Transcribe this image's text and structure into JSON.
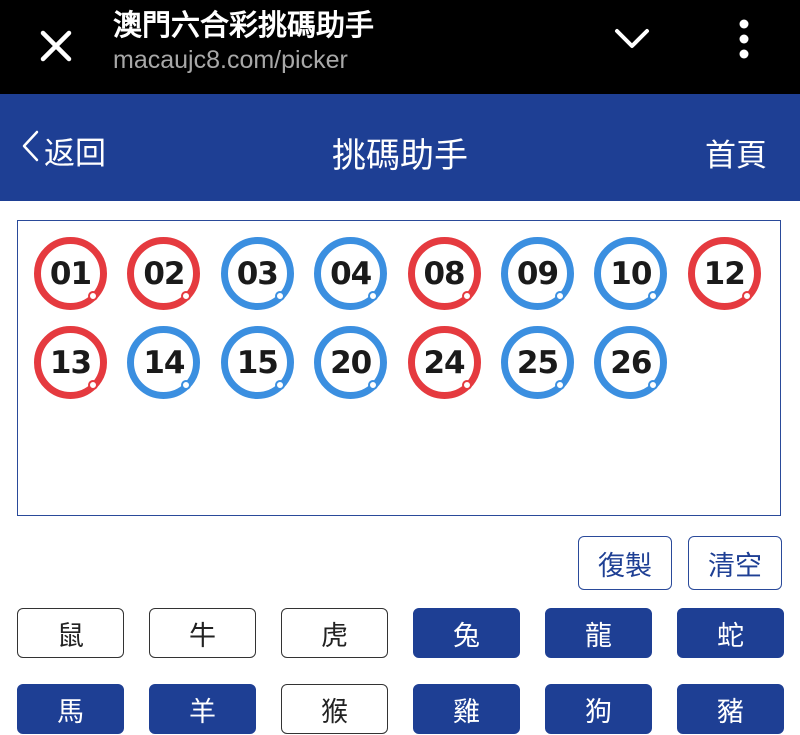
{
  "browser_bar": {
    "title": "澳門六合彩挑碼助手",
    "url": "macaujc8.com/picker",
    "icons": [
      "close-icon",
      "chevron-down-icon",
      "more-vert-icon"
    ]
  },
  "header": {
    "back_label": "返回",
    "title": "挑碼助手",
    "home_label": "首頁"
  },
  "colors": {
    "header_bg": "#1e3f94",
    "ball_red": "#e53a3f",
    "ball_blue": "#3b8fe0",
    "active_zodiac_bg": "#1e3f94"
  },
  "balls": [
    {
      "number": "01",
      "color": "red"
    },
    {
      "number": "02",
      "color": "red"
    },
    {
      "number": "03",
      "color": "blue"
    },
    {
      "number": "04",
      "color": "blue"
    },
    {
      "number": "08",
      "color": "red"
    },
    {
      "number": "09",
      "color": "blue"
    },
    {
      "number": "10",
      "color": "blue"
    },
    {
      "number": "12",
      "color": "red"
    },
    {
      "number": "13",
      "color": "red"
    },
    {
      "number": "14",
      "color": "blue"
    },
    {
      "number": "15",
      "color": "blue"
    },
    {
      "number": "20",
      "color": "blue"
    },
    {
      "number": "24",
      "color": "red"
    },
    {
      "number": "25",
      "color": "blue"
    },
    {
      "number": "26",
      "color": "blue"
    }
  ],
  "actions": {
    "copy_label": "復製",
    "clear_label": "清空"
  },
  "zodiacs": [
    {
      "label": "鼠",
      "selected": false
    },
    {
      "label": "牛",
      "selected": false
    },
    {
      "label": "虎",
      "selected": false
    },
    {
      "label": "兔",
      "selected": true
    },
    {
      "label": "龍",
      "selected": true
    },
    {
      "label": "蛇",
      "selected": true
    },
    {
      "label": "馬",
      "selected": true
    },
    {
      "label": "羊",
      "selected": true
    },
    {
      "label": "猴",
      "selected": false
    },
    {
      "label": "雞",
      "selected": true
    },
    {
      "label": "狗",
      "selected": true
    },
    {
      "label": "豬",
      "selected": true
    }
  ]
}
